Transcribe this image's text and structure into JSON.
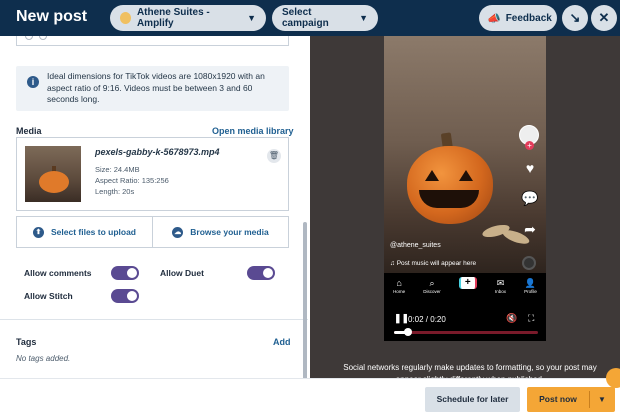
{
  "header": {
    "title": "New post",
    "account": "Athene Suites - Amplify",
    "campaign": "Select campaign",
    "feedback": "Feedback"
  },
  "info_text": "Ideal dimensions for TikTok videos are 1080x1920 with an aspect ratio of 9:16. Videos must be between 3 and 60 seconds long.",
  "media": {
    "label": "Media",
    "open_library": "Open media library",
    "file_name": "pexels-gabby-k-5678973.mp4",
    "size": "Size: 24.4MB",
    "aspect": "Aspect Ratio: 135:256",
    "length": "Length: 20s",
    "select_files": "Select files to upload",
    "browse_media": "Browse your media"
  },
  "settings": {
    "allow_comments": "Allow comments",
    "allow_duet": "Allow Duet",
    "allow_stitch": "Allow Stitch",
    "comments_on": true,
    "duet_on": true,
    "stitch_on": true
  },
  "tags": {
    "label": "Tags",
    "add": "Add",
    "empty": "No tags added."
  },
  "preview": {
    "handle": "@athene_suites",
    "music": "Post music will appear here",
    "nav": [
      "Home",
      "Discover",
      "",
      "Inbox",
      "Profile"
    ],
    "time": "0:02 / 0:20",
    "progress": 0.1,
    "notice": "Social networks regularly make updates to formatting, so your post may appear slightly differently when published."
  },
  "footer": {
    "schedule": "Schedule for later",
    "post_now": "Post now"
  },
  "colors": {
    "header_bg": "#0e2e4d",
    "toggle": "#5a4a92",
    "primary_button": "#f4a636",
    "link": "#1f5f91"
  }
}
